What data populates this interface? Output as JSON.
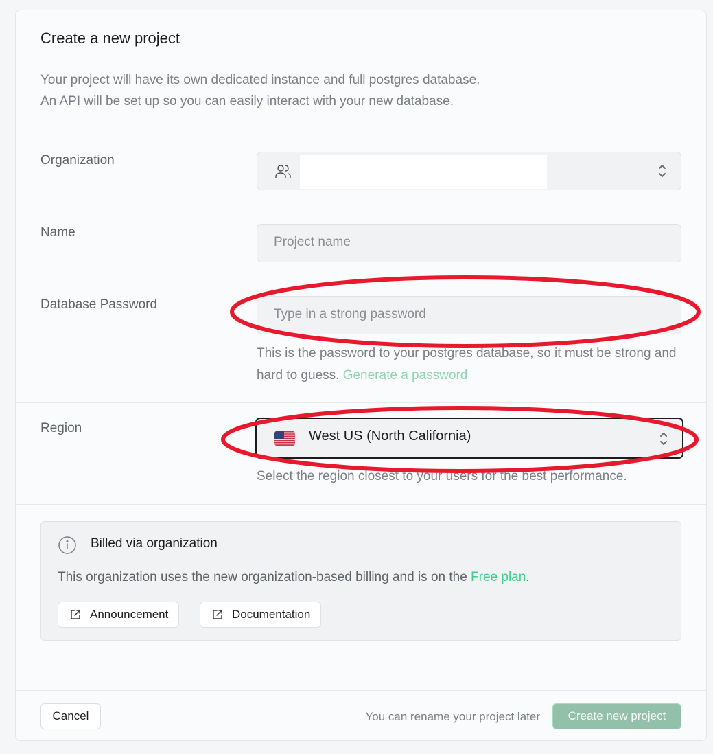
{
  "dialog": {
    "title": "Create a new project",
    "description_line1": "Your project will have its own dedicated instance and full postgres database.",
    "description_line2": "An API will be set up so you can easily interact with your new database."
  },
  "organization": {
    "label": "Organization",
    "value": "",
    "icon": "users-icon"
  },
  "name": {
    "label": "Name",
    "placeholder": "Project name",
    "value": ""
  },
  "password": {
    "label": "Database Password",
    "placeholder": "Type in a strong password",
    "value": "",
    "help_text": "This is the password to your postgres database, so it must be strong and hard to guess.",
    "generate_link": "Generate a password"
  },
  "region": {
    "label": "Region",
    "value": "West US (North California)",
    "flag": "us-flag-icon",
    "help_text": "Select the region closest to your users for the best performance."
  },
  "billing": {
    "title": "Billed via organization",
    "text_before": "This organization uses the new organization-based billing and is on the ",
    "plan": "Free plan",
    "text_after": ".",
    "buttons": [
      {
        "label": "Announcement",
        "icon": "external-link-icon"
      },
      {
        "label": "Documentation",
        "icon": "external-link-icon"
      }
    ]
  },
  "footer": {
    "cancel_label": "Cancel",
    "rename_note": "You can rename your project later",
    "create_label": "Create new project"
  },
  "colors": {
    "brand_green": "#3ecf8e",
    "create_button_disabled": "#93c0a9",
    "annotation_red": "#e8192c"
  }
}
